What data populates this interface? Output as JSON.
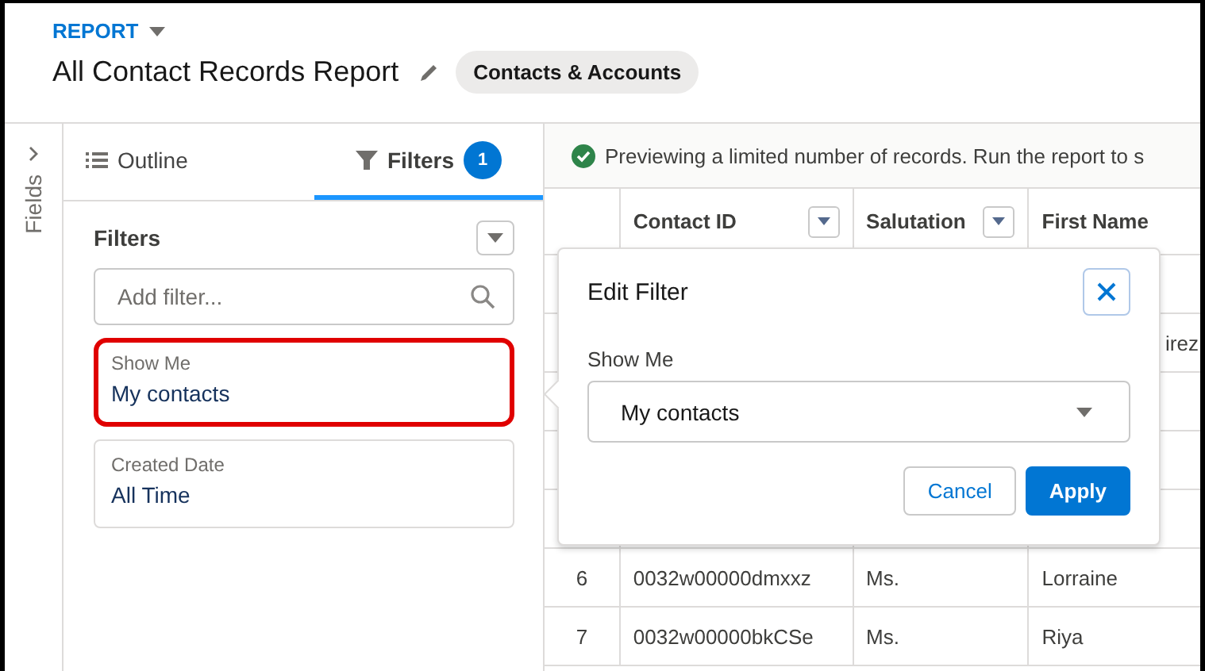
{
  "header": {
    "eyebrow": "REPORT",
    "title": "All Contact Records Report",
    "report_type": "Contacts & Accounts"
  },
  "side_tab": {
    "label": "Fields"
  },
  "tabs": [
    {
      "label": "Outline",
      "selected": false
    },
    {
      "label": "Filters",
      "selected": true,
      "count": "1"
    }
  ],
  "filters_panel": {
    "heading": "Filters",
    "search": {
      "placeholder": "Add filter..."
    },
    "filters": [
      {
        "label": "Show Me",
        "value": "My contacts",
        "highlighted": true
      },
      {
        "label": "Created Date",
        "value": "All Time",
        "highlighted": false
      }
    ]
  },
  "preview_notice": "Previewing a limited number of records. Run the report to s",
  "table": {
    "columns": [
      {
        "label": "Contact ID",
        "menu": true
      },
      {
        "label": "Salutation",
        "menu": true
      },
      {
        "label": "First Name"
      }
    ],
    "rows": [
      {
        "number": "",
        "cells": [
          "",
          "",
          ""
        ]
      },
      {
        "number": "",
        "cells": [
          "",
          "",
          "irez"
        ]
      },
      {
        "number": "",
        "cells": [
          "",
          "",
          ""
        ]
      },
      {
        "number": "",
        "cells": [
          "",
          "",
          ""
        ]
      },
      {
        "number": "",
        "cells": [
          "",
          "",
          ""
        ]
      },
      {
        "number": "6",
        "cells": [
          "0032w00000dmxxz",
          "Ms.",
          "Lorraine"
        ]
      },
      {
        "number": "7",
        "cells": [
          "0032w00000bkCSe",
          "Ms.",
          "Riya"
        ]
      }
    ]
  },
  "edit_filter": {
    "title": "Edit Filter",
    "field_label": "Show Me",
    "value": "My contacts",
    "buttons": [
      {
        "label": "Cancel",
        "kind": "neutral"
      },
      {
        "label": "Apply",
        "kind": "brand"
      }
    ]
  }
}
